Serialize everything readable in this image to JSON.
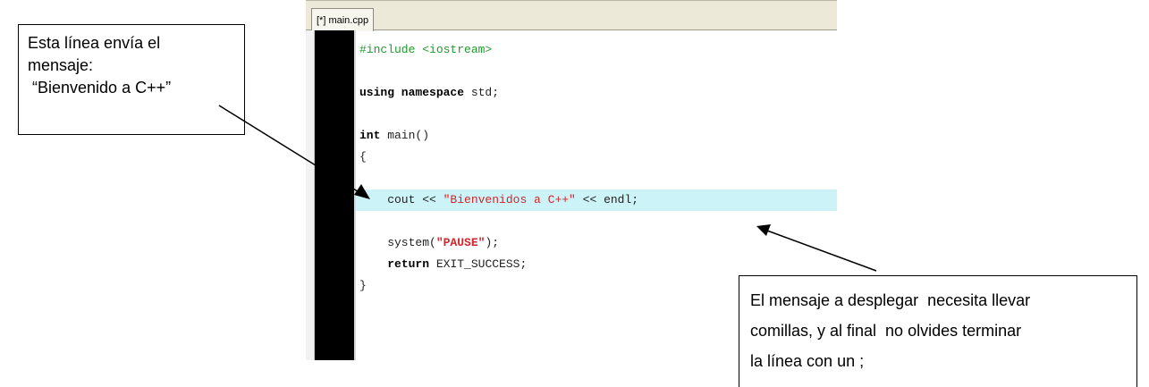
{
  "editor": {
    "tab_label": "[*] main.cpp",
    "code_lines": [
      {
        "parts": [
          {
            "text": "#include <iostream>",
            "cls": "pre"
          }
        ]
      },
      {
        "parts": []
      },
      {
        "parts": [
          {
            "text": "using namespace",
            "cls": "kw"
          },
          {
            "text": " std;",
            "cls": ""
          }
        ]
      },
      {
        "parts": []
      },
      {
        "parts": [
          {
            "text": "int",
            "cls": "kw"
          },
          {
            "text": " main()",
            "cls": ""
          }
        ]
      },
      {
        "parts": [
          {
            "text": "{",
            "cls": ""
          }
        ]
      },
      {
        "parts": []
      },
      {
        "parts": [
          {
            "text": "    cout << ",
            "cls": ""
          },
          {
            "text": "\"Bienvenidos a C++\"",
            "cls": "str"
          },
          {
            "text": " << endl;",
            "cls": ""
          }
        ],
        "highlight": true
      },
      {
        "parts": []
      },
      {
        "parts": [
          {
            "text": "    system(",
            "cls": ""
          },
          {
            "text": "\"PAUSE\"",
            "cls": "strb"
          },
          {
            "text": ");",
            "cls": ""
          }
        ]
      },
      {
        "parts": [
          {
            "text": "    ",
            "cls": ""
          },
          {
            "text": "return",
            "cls": "kw"
          },
          {
            "text": " EXIT_SUCCESS;",
            "cls": ""
          }
        ]
      },
      {
        "parts": [
          {
            "text": "}",
            "cls": ""
          }
        ]
      }
    ]
  },
  "callouts": {
    "left_lines": [
      "Esta línea envía el",
      "mensaje:",
      " “Bienvenido a C++”"
    ],
    "right_lines": [
      "El mensaje a desplegar  necesita llevar",
      "comillas, y al final  no olvides terminar",
      "la línea con un ;"
    ]
  },
  "colors": {
    "highlight": "#ccf4f8",
    "preprocessor": "#239a2e",
    "string": "#d0262c",
    "gutter": "#000000"
  }
}
